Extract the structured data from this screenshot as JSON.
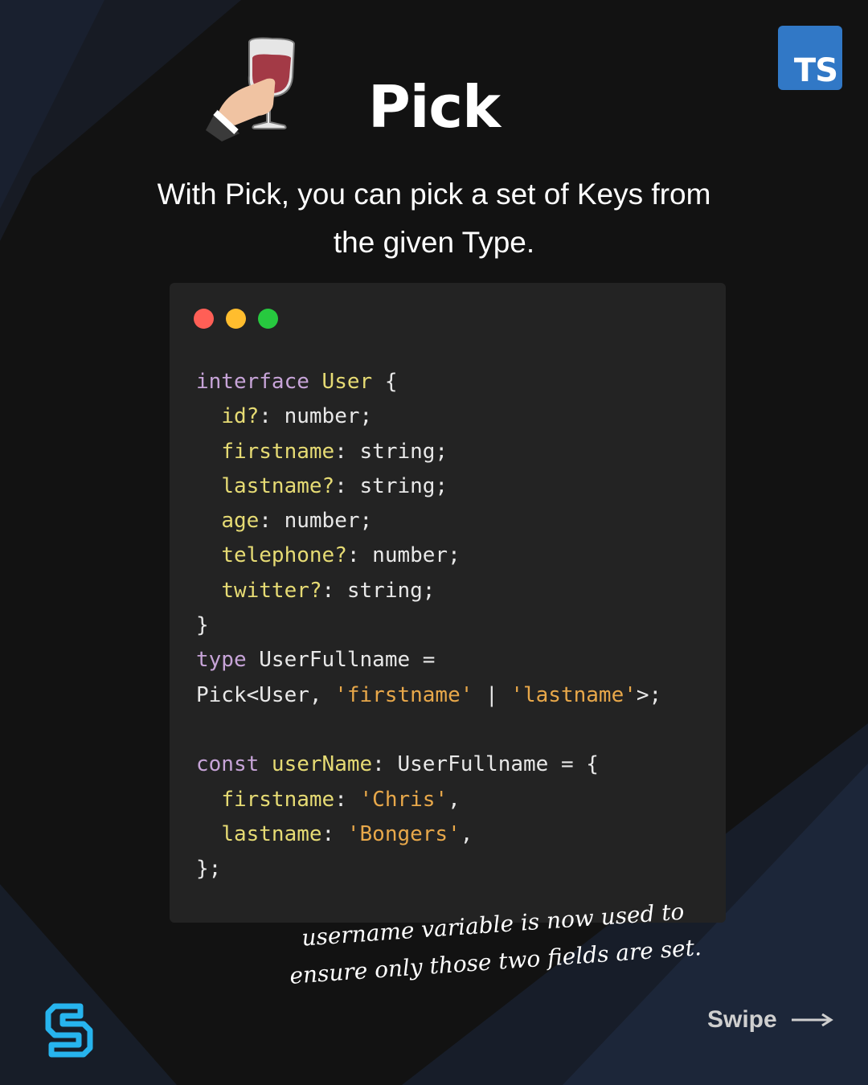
{
  "badge": {
    "text": "TS",
    "color": "#3178c6"
  },
  "header": {
    "title": "Pick",
    "subtitle_line1": "With Pick, you can pick a set of Keys from",
    "subtitle_line2": "the given Type.",
    "emoji_icon": "wine-glass-hand-icon"
  },
  "code_window": {
    "dots": [
      "#ff5f56",
      "#ffbd2e",
      "#27c93f"
    ],
    "lines": [
      [
        {
          "t": "interface ",
          "c": "kw"
        },
        {
          "t": "User",
          "c": "type"
        },
        {
          "t": " {",
          "c": "plain"
        }
      ],
      [
        {
          "t": "  ",
          "c": "plain"
        },
        {
          "t": "id?",
          "c": "prop"
        },
        {
          "t": ": number;",
          "c": "plain"
        }
      ],
      [
        {
          "t": "  ",
          "c": "plain"
        },
        {
          "t": "firstname",
          "c": "prop"
        },
        {
          "t": ": string;",
          "c": "plain"
        }
      ],
      [
        {
          "t": "  ",
          "c": "plain"
        },
        {
          "t": "lastname?",
          "c": "prop"
        },
        {
          "t": ": string;",
          "c": "plain"
        }
      ],
      [
        {
          "t": "  ",
          "c": "plain"
        },
        {
          "t": "age",
          "c": "prop"
        },
        {
          "t": ": number;",
          "c": "plain"
        }
      ],
      [
        {
          "t": "  ",
          "c": "plain"
        },
        {
          "t": "telephone?",
          "c": "prop"
        },
        {
          "t": ": number;",
          "c": "plain"
        }
      ],
      [
        {
          "t": "  ",
          "c": "plain"
        },
        {
          "t": "twitter?",
          "c": "prop"
        },
        {
          "t": ": string;",
          "c": "plain"
        }
      ],
      [
        {
          "t": "}",
          "c": "plain"
        }
      ],
      [
        {
          "t": "type ",
          "c": "kw"
        },
        {
          "t": "UserFullname =",
          "c": "plain"
        }
      ],
      [
        {
          "t": "Pick<User, ",
          "c": "plain"
        },
        {
          "t": "'firstname'",
          "c": "str"
        },
        {
          "t": " | ",
          "c": "plain"
        },
        {
          "t": "'lastname'",
          "c": "str"
        },
        {
          "t": ">;",
          "c": "plain"
        }
      ],
      [
        {
          "t": "",
          "c": "plain"
        }
      ],
      [
        {
          "t": "const ",
          "c": "kw"
        },
        {
          "t": "userName",
          "c": "prop"
        },
        {
          "t": ": UserFullname = {",
          "c": "plain"
        }
      ],
      [
        {
          "t": "  ",
          "c": "plain"
        },
        {
          "t": "firstname",
          "c": "prop"
        },
        {
          "t": ": ",
          "c": "plain"
        },
        {
          "t": "'Chris'",
          "c": "str"
        },
        {
          "t": ",",
          "c": "plain"
        }
      ],
      [
        {
          "t": "  ",
          "c": "plain"
        },
        {
          "t": "lastname",
          "c": "prop"
        },
        {
          "t": ": ",
          "c": "plain"
        },
        {
          "t": "'Bongers'",
          "c": "str"
        },
        {
          "t": ",",
          "c": "plain"
        }
      ],
      [
        {
          "t": "};",
          "c": "plain"
        }
      ]
    ]
  },
  "note": {
    "line1": "username variable is now used to",
    "line2": "ensure only those two fields are set."
  },
  "footer": {
    "logo_icon": "brand-logo-icon",
    "swipe_label": "Swipe",
    "arrow_icon": "arrow-right-icon"
  }
}
